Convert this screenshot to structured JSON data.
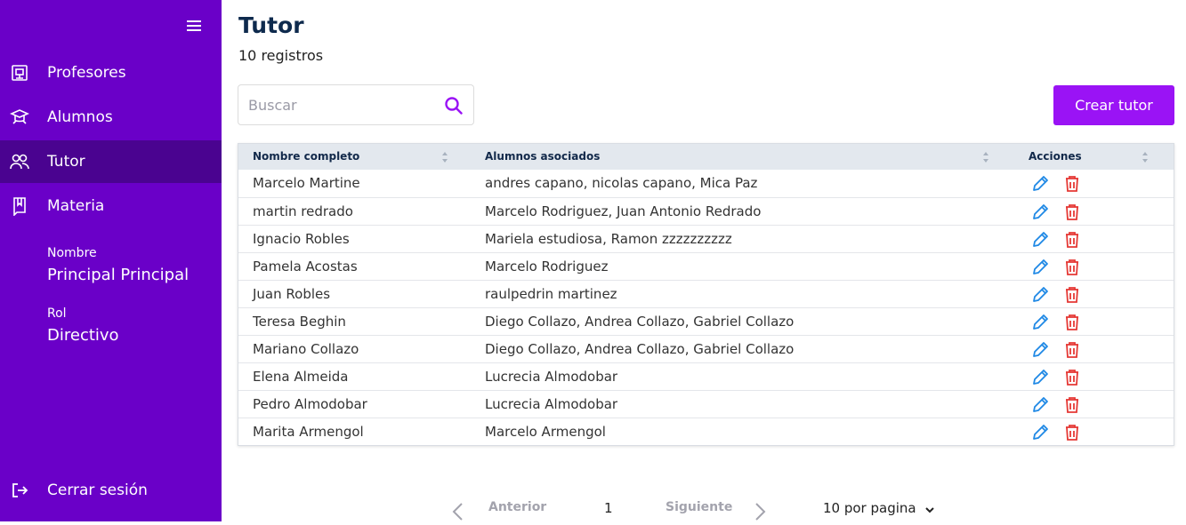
{
  "sidebar": {
    "items": [
      {
        "label": "Profesores",
        "icon": "presentation-icon"
      },
      {
        "label": "Alumnos",
        "icon": "graduation-cap-icon"
      },
      {
        "label": "Tutor",
        "icon": "users-icon"
      },
      {
        "label": "Materia",
        "icon": "book-icon"
      }
    ],
    "active_item": "Tutor",
    "user": {
      "name_label": "Nombre",
      "name_value": "Principal Principal",
      "role_label": "Rol",
      "role_value": "Directivo"
    },
    "logout_label": "Cerrar sesión"
  },
  "header": {
    "title": "Tutor",
    "count": "10 registros"
  },
  "search": {
    "placeholder": "Buscar",
    "value": ""
  },
  "create_button": "Crear tutor",
  "table": {
    "columns": [
      "Nombre completo",
      "Alumnos asociados",
      "Acciones"
    ],
    "rows": [
      {
        "name": "Marcelo Martine",
        "students": "andres capano, nicolas capano, Mica Paz"
      },
      {
        "name": "martin redrado",
        "students": "Marcelo Rodriguez, Juan Antonio Redrado"
      },
      {
        "name": "Ignacio Robles",
        "students": "Mariela estudiosa, Ramon zzzzzzzzzz"
      },
      {
        "name": "Pamela Acostas",
        "students": "Marcelo Rodriguez"
      },
      {
        "name": "Juan Robles",
        "students": "raulpedrin martinez"
      },
      {
        "name": "Teresa Beghin",
        "students": "Diego Collazo, Andrea Collazo, Gabriel Collazo"
      },
      {
        "name": "Mariano Collazo",
        "students": "Diego Collazo, Andrea Collazo, Gabriel Collazo"
      },
      {
        "name": "Elena Almeida",
        "students": "Lucrecia Almodobar"
      },
      {
        "name": "Pedro Almodobar",
        "students": "Lucrecia Almodobar"
      },
      {
        "name": "Marita Armengol",
        "students": "Marcelo Armengol"
      }
    ]
  },
  "pagination": {
    "prev_label": "Anterior",
    "current_page": "1",
    "next_label": "Siguiente",
    "page_size_label": "10 por pagina"
  },
  "colors": {
    "sidebar_bg": "#6a00c8",
    "sidebar_active": "#4a0390",
    "primary_button": "#9a13f5",
    "edit_icon": "#1e88e5",
    "delete_icon": "#e53935",
    "title_text": "#0e2a4d"
  }
}
